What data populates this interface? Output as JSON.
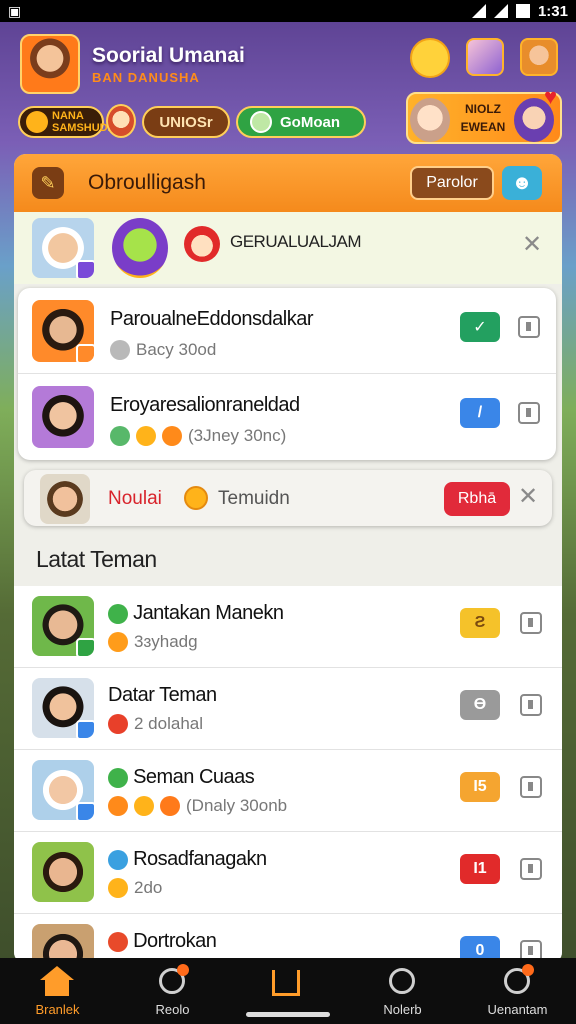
{
  "status_bar": {
    "time": "1:31"
  },
  "header": {
    "app_title": "Soorial Umanai",
    "app_subtitle": "BAN DANUSHA",
    "pills": {
      "level": "NANA SAMSHUDA",
      "button2": "UNIOSr",
      "button3": "GoMoan"
    },
    "promo_text": "NIOLZ EWEAN"
  },
  "panel": {
    "title": "Obroulligash",
    "header_button": "Parolor",
    "notice": {
      "text": "GERUALUALJAM"
    },
    "requests": [
      {
        "name": "ParoualneEddonsdalkar",
        "sub": "Bacy 30od",
        "action_color": "#23a060",
        "action_icon": "✓"
      },
      {
        "name": "Eroyaresalionraneldad",
        "sub": "(3Jney 30nc)",
        "action_color": "#3a86e8",
        "action_icon": "/"
      }
    ],
    "banner": {
      "label": "Noulai",
      "text": "Temuidn",
      "button": "Rbhā"
    },
    "section_title": "Latat Teman",
    "friends": [
      {
        "name": "Jantakan Manekn",
        "sub": "3ɜyhadg",
        "action_color": "#f5c22a",
        "action_text": "Ƨ"
      },
      {
        "name": "Datar Teman",
        "sub": "2 dolahal",
        "action_color": "#9a9a9a",
        "action_text": "Ɵ"
      },
      {
        "name": "Seman Cuaas",
        "sub": "(Dnaly 30onb",
        "action_color": "#f5a530",
        "action_text": "I5"
      },
      {
        "name": "Rosadfanagakn",
        "sub": "2do",
        "action_color": "#e12a2a",
        "action_text": "I1"
      },
      {
        "name": "Dortrokan",
        "sub": "",
        "action_color": "#3a86e8",
        "action_text": "0"
      }
    ]
  },
  "bottom_nav": [
    {
      "label": "Branlek",
      "icon": "home-icon"
    },
    {
      "label": "Reolo",
      "icon": "profile-icon"
    },
    {
      "label": "",
      "icon": "house-outline-icon"
    },
    {
      "label": "Nolerb",
      "icon": "search-icon"
    },
    {
      "label": "Uenantam",
      "icon": "user-icon"
    }
  ]
}
